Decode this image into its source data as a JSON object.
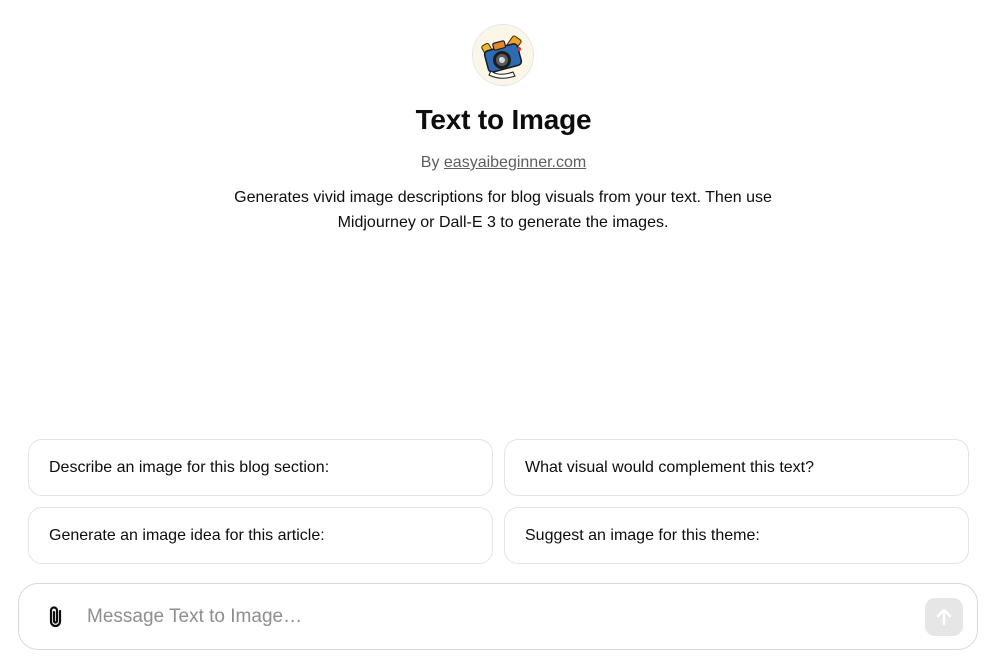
{
  "gpt": {
    "title": "Text to Image",
    "byline_prefix": "By ",
    "author": "easyaibeginner.com",
    "description": "Generates vivid image descriptions for blog visuals from your text. Then use Midjourney or Dall-E 3 to generate the images.",
    "avatar_icon": "camera-illustration-icon"
  },
  "starters": [
    {
      "label": "Describe an image for this blog section:"
    },
    {
      "label": "What visual would complement this text?"
    },
    {
      "label": "Generate an image idea for this article:"
    },
    {
      "label": "Suggest an image for this theme:"
    }
  ],
  "composer": {
    "placeholder": "Message Text to Image…",
    "attach_icon": "paperclip-icon",
    "send_icon": "arrow-up-icon"
  },
  "colors": {
    "text": "#0d0d0d",
    "muted": "#5d5d5d",
    "placeholder": "#8e8e8e",
    "border": "#e3e3e3",
    "send_disabled": "#e6e6e6"
  }
}
